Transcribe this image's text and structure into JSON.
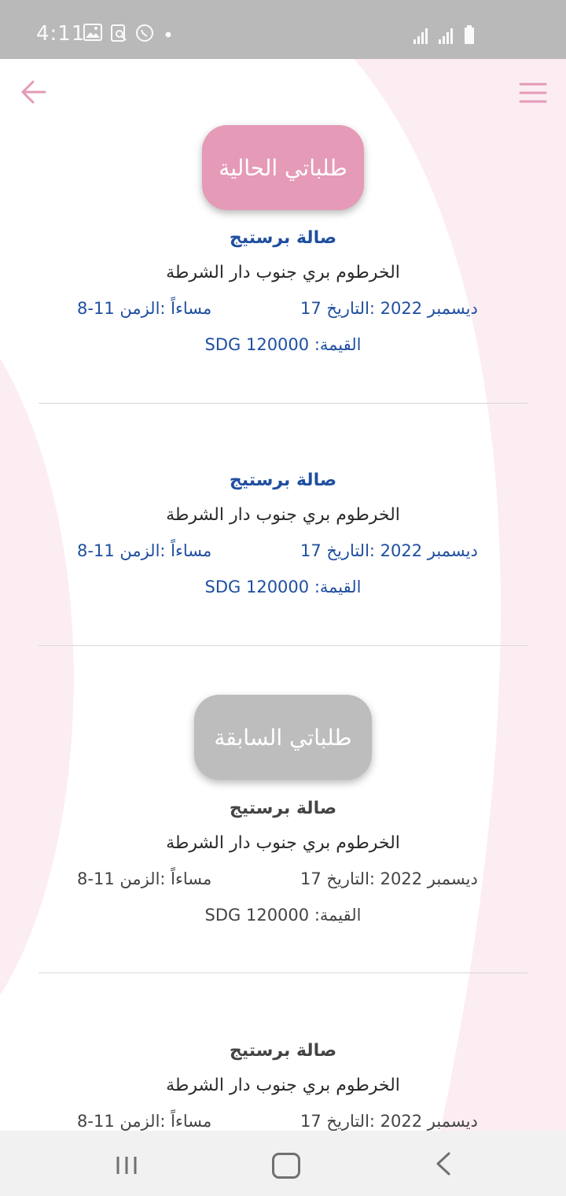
{
  "status_bar": {
    "time": "4:11"
  },
  "header": {
    "back_icon": "arrow-left-icon",
    "menu_icon": "hamburger-menu-icon"
  },
  "sections": {
    "current_label": "طلباتي الحالية",
    "previous_label": "طلباتي السابقة"
  },
  "orders_current": [
    {
      "name": "صالة برستيج",
      "location": "الخرطوم بري جنوب دار الشرطة",
      "time": "مساءاً :الزمن 11-8",
      "date": "ديسمبر 2022 :التاريخ 17",
      "price": "القيمة: 120000 SDG"
    },
    {
      "name": "صالة برستيج",
      "location": "الخرطوم بري جنوب دار الشرطة",
      "time": "مساءاً :الزمن 11-8",
      "date": "ديسمبر 2022 :التاريخ 17",
      "price": "القيمة: 120000 SDG"
    }
  ],
  "orders_previous": [
    {
      "name": "صالة برستيج",
      "location": "الخرطوم بري جنوب دار الشرطة",
      "time": "مساءاً :الزمن 11-8",
      "date": "ديسمبر 2022 :التاريخ 17",
      "price": "القيمة: 120000 SDG"
    },
    {
      "name": "صالة برستيج",
      "location": "الخرطوم بري جنوب دار الشرطة",
      "time": "مساءاً :الزمن 11-8",
      "date": "ديسمبر 2022 :التاريخ 17"
    }
  ],
  "colors": {
    "accent": "#e59ab7",
    "text_blue": "#1f4fa0",
    "inactive": "#bdbdbd"
  }
}
